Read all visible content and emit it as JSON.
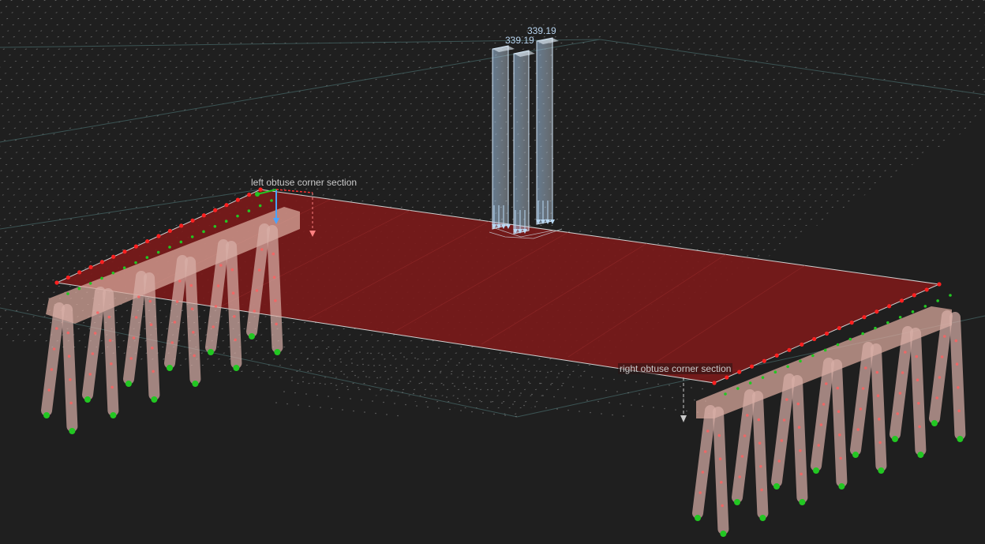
{
  "viewport": {
    "background_color": "#1f1f1f",
    "grid_dot_color": "#9a9a9a",
    "grid_line_color": "#3f5a5a",
    "slab_color": "#7a1a1a",
    "pier_color": "#d9b0a8",
    "support_color": "#22c722",
    "node_color": "#ff2020",
    "load_color": "#b8d8f4"
  },
  "labels": {
    "left_section": "left obtuse corner section",
    "right_section": "right obtuse corner section"
  },
  "loads": {
    "value_1": "339.19",
    "value_2": "339.19"
  }
}
